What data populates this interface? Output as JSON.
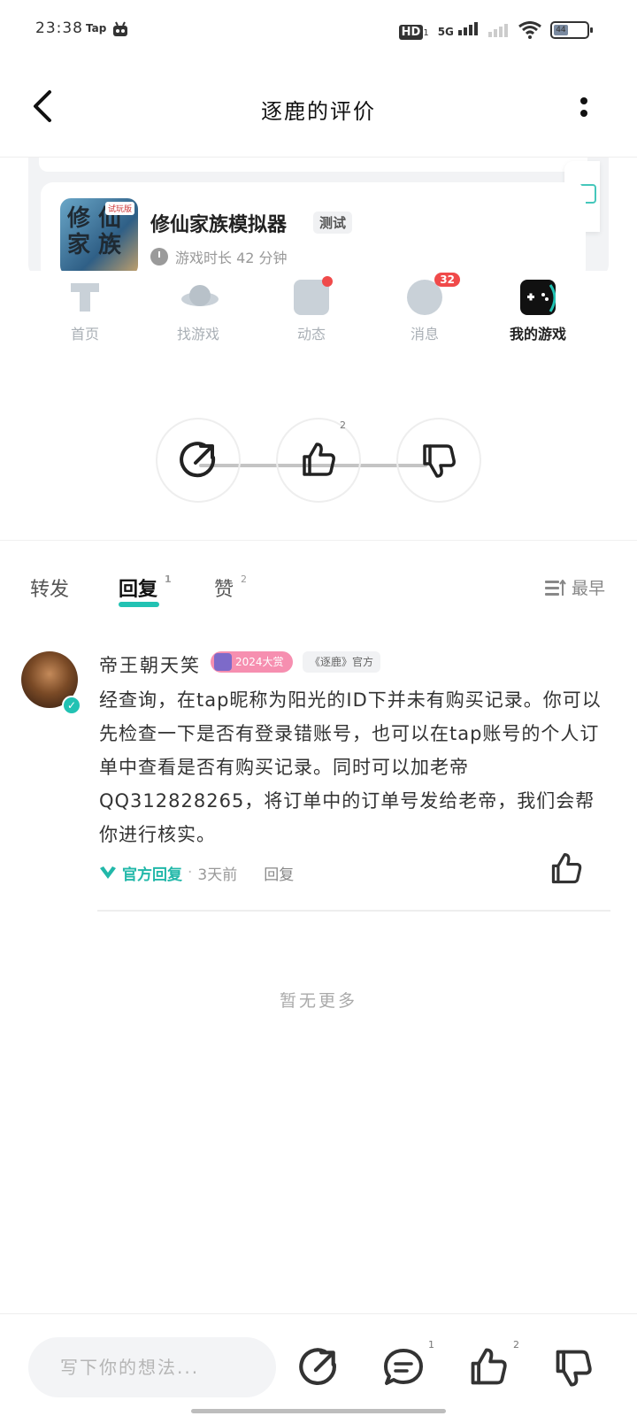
{
  "status_bar": {
    "time": "23:38",
    "app": "Tap",
    "hd": "HD",
    "hd_sub": "1",
    "network": "5G",
    "battery": "44"
  },
  "header": {
    "title": "逐鹿的评价"
  },
  "embedded_card": {
    "game_name": "修仙家族模拟器",
    "game_tag": "测试",
    "play_time": "游戏时长 42 分钟",
    "icon_text": "修 仙\n家 族",
    "icon_badge": "试玩版",
    "nav": [
      {
        "label": "首页"
      },
      {
        "label": "找游戏"
      },
      {
        "label": "动态"
      },
      {
        "label": "消息",
        "badge": "32"
      },
      {
        "label": "我的游戏"
      }
    ]
  },
  "actions": {
    "like_count": "2"
  },
  "tabs": {
    "repost": "转发",
    "reply": "回复",
    "reply_count": "1",
    "like": "赞",
    "like_count": "2",
    "sort": "最早"
  },
  "comment": {
    "author": "帝王朝天笑",
    "year_badge": "2024大赏",
    "official_badge": "《逐鹿》官方",
    "body": "经查询，在tap昵称为阳光的ID下并未有购买记录。你可以先检查一下是否有登录错账号，也可以在tap账号的个人订单中查看是否有购买记录。同时可以加老帝QQ312828265，将订单中的订单号发给老帝，我们会帮你进行核实。",
    "official_reply": "官方回复",
    "separator": "·",
    "time": "3天前",
    "reply_label": "回复"
  },
  "no_more": "暂无更多",
  "bottom_bar": {
    "input_placeholder": "写下你的想法...",
    "comment_count": "1",
    "like_count": "2"
  },
  "colors": {
    "accent": "#22c2b3",
    "badge_red": "#f04a4a",
    "year_badge_pink": "#f68fb0"
  }
}
